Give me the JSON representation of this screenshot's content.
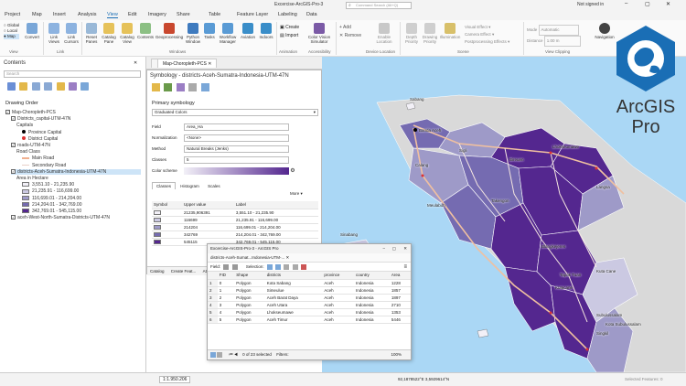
{
  "window": {
    "title": "Excercise-ArcGIS-Pro-3",
    "search_placeholder": "Command Search (Alt+Q)",
    "signin": "Not signed in"
  },
  "ribbon_tabs": [
    "Project",
    "Map",
    "Insert",
    "Analysis",
    "View",
    "Edit",
    "Imagery",
    "Share",
    "Table",
    "Feature Layer",
    "Labeling",
    "Data"
  ],
  "ribbon": {
    "buttons": [
      "Convert",
      "Link Views",
      "Link Cursors",
      "Reset Panes",
      "Catalog Pane",
      "Catalog View",
      "Contents",
      "Geoprocessing",
      "Python Window",
      "Tasks",
      "Workflow Manager",
      "Aviation",
      "Indoors",
      "Create",
      "Import",
      "Color Vision Simulator",
      "Add",
      "Remove",
      "Enable Location",
      "Depth Priority",
      "Drawing Priority",
      "Illumination",
      "Visual Effect",
      "Camera Effect",
      "Postprocessing Effects",
      "Mode",
      "Distance",
      "Navigation"
    ],
    "radio_items": [
      "Global",
      "Local",
      "Map"
    ],
    "mode_value": "Automatic",
    "distance_value": "1.00 m",
    "groups": [
      "View",
      "Link",
      "Windows",
      "Accessibility",
      "Animation",
      "Device Location",
      "Scene",
      "View Clipping"
    ]
  },
  "contents": {
    "title": "Contents",
    "search_placeholder": "Search",
    "drawing_order": "Drawing Order",
    "items": [
      {
        "label": "Map-Choropleth-PCS",
        "level": 0,
        "checked": true
      },
      {
        "label": "Districts_capital-UTM-47N",
        "level": 1,
        "checked": true
      },
      {
        "label": "Capitals",
        "level": 2
      },
      {
        "label": "Province Capital",
        "level": 3,
        "symbol": "circle-black"
      },
      {
        "label": "District Capital",
        "level": 3,
        "symbol": "circle-red"
      },
      {
        "label": "roads-UTM-47N",
        "level": 1,
        "checked": true
      },
      {
        "label": "Road Class",
        "level": 2
      },
      {
        "label": "Main Road",
        "level": 3,
        "symbol": "line-main"
      },
      {
        "label": "Secondary Road",
        "level": 3,
        "symbol": "line-secondary"
      },
      {
        "label": "districts-Aceh-Sumatra-Indonesia-UTM-47N",
        "level": 1,
        "checked": true,
        "selected": true
      },
      {
        "label": "Area in Hectare",
        "level": 2
      },
      {
        "label": "3,551.10 - 21,235.90",
        "level": 3,
        "color": "#f2f0f7"
      },
      {
        "label": "21,235.91 - 116,699.00",
        "level": 3,
        "color": "#cbc9e2"
      },
      {
        "label": "116,699.01 - 214,204.00",
        "level": 3,
        "color": "#9e9ac8"
      },
      {
        "label": "214,204.01 - 342,769.00",
        "level": 3,
        "color": "#756bb1"
      },
      {
        "label": "342,769.01 - 545,115.00",
        "level": 3,
        "color": "#54278f"
      },
      {
        "label": "aceh-West-North-Sumatra-Districts-UTM-47N",
        "level": 1,
        "checked": true
      }
    ]
  },
  "map_tab": "Map-Choropleth-PCS",
  "symbology": {
    "title": "Symbology - districts-Aceh-Sumatra-Indonesia-UTM-47N",
    "primary": "Primary symbology",
    "method_type": "Graduated Colors",
    "field_label": "Field",
    "field_value": "Area_Ha",
    "normalization_label": "Normalization",
    "normalization_value": "<None>",
    "method_label": "Method",
    "method_value": "Natural Breaks (Jenks)",
    "classes_label": "Classes",
    "classes_value": "5",
    "color_scheme_label": "Color scheme",
    "subtabs": [
      "Classes",
      "Histogram",
      "Scales"
    ],
    "more": "More",
    "columns": [
      "Symbol",
      "Upper value",
      "Label"
    ],
    "rows": [
      {
        "color": "#f2f0f7",
        "upper": "21235,906391",
        "label": "3,551.10 - 21,235.90"
      },
      {
        "color": "#cbc9e2",
        "upper": "116699",
        "label": "21,235.91 - 116,699.00"
      },
      {
        "color": "#9e9ac8",
        "upper": "214204",
        "label": "116,699.01 - 214,204.00"
      },
      {
        "color": "#756bb1",
        "upper": "342769",
        "label": "214,204.01 - 342,769.00"
      },
      {
        "color": "#54278f",
        "upper": "545115",
        "label": "342,769.01 - 545,115.00"
      }
    ],
    "bottom_tabs": [
      "Catalog",
      "Create Feat...",
      "Attrib"
    ]
  },
  "attribute_table": {
    "window_title": "Excercise-ArcGIS-Pro-3 - ArcGIS Pro",
    "tab": "districts-Aceh-Sumat...Indonesia-UTM-...",
    "field_label": "Field:",
    "selection_label": "Selection:",
    "columns": [
      "FID",
      "Shape",
      "districts",
      "province",
      "country",
      "Area"
    ],
    "rows": [
      [
        "0",
        "Polygon",
        "Kota Sabang",
        "Aceh",
        "Indonesia",
        "1228"
      ],
      [
        "1",
        "Polygon",
        "Simeulue",
        "Aceh",
        "Indonesia",
        "1857"
      ],
      [
        "2",
        "Polygon",
        "Aceh Barat Daya",
        "Aceh",
        "Indonesia",
        "1897"
      ],
      [
        "3",
        "Polygon",
        "Aceh Utara",
        "Aceh",
        "Indonesia",
        "2710"
      ],
      [
        "4",
        "Polygon",
        "Lhokseumawe",
        "Aceh",
        "Indonesia",
        "1353"
      ],
      [
        "5",
        "Polygon",
        "Aceh Timur",
        "Aceh",
        "Indonesia",
        "5446"
      ]
    ],
    "status": "0 of 23 selected",
    "filters": "Filters:",
    "zoom": "100%"
  },
  "map_labels": [
    "Sabang",
    "Banda Aceh",
    "Lhokseumawe",
    "Langsa",
    "Sigli",
    "Bireuen",
    "Takengon",
    "Blangkejeren",
    "Kutacane",
    "Meulaboh",
    "Calang",
    "Kuta Cane",
    "Tapak Tuan",
    "Subulussalam",
    "Singkil",
    "Sinabang",
    "Kota Subulussalam"
  ],
  "statusbar": {
    "scale": "1:1.950.206",
    "coords": "92,1878522°E 3,5929614°N",
    "selected": "Selected Features: 0"
  },
  "logo": {
    "line1": "ArcGIS",
    "line2": "Pro"
  },
  "colors": {
    "accent": "#1a6eb5",
    "ocean": "#aad7f5",
    "land": "#d9d9d9"
  }
}
